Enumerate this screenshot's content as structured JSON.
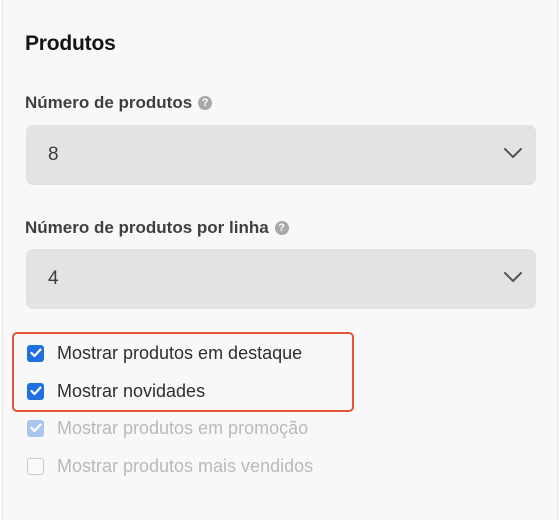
{
  "section": {
    "title": "Produtos"
  },
  "fields": [
    {
      "label": "Número de produtos",
      "help_icon": "?",
      "value": "8"
    },
    {
      "label": "Número de produtos por linha",
      "help_icon": "?",
      "value": "4"
    }
  ],
  "checkboxes": [
    {
      "label": "Mostrar produtos em destaque",
      "checked": true,
      "disabled": false
    },
    {
      "label": "Mostrar novidades",
      "checked": true,
      "disabled": false
    },
    {
      "label": "Mostrar produtos em promoção",
      "checked": true,
      "disabled": true
    },
    {
      "label": "Mostrar produtos mais vendidos",
      "checked": false,
      "disabled": true
    }
  ],
  "colors": {
    "checkbox_checked": "#1f6fe0",
    "checkbox_checked_disabled": "#a9c6ee",
    "highlight_border": "#e4543a",
    "select_background": "#e3e3e3"
  },
  "icons": {
    "help": "question-circle-icon",
    "dropdown": "chevron-down-icon",
    "check": "checkmark-icon"
  }
}
